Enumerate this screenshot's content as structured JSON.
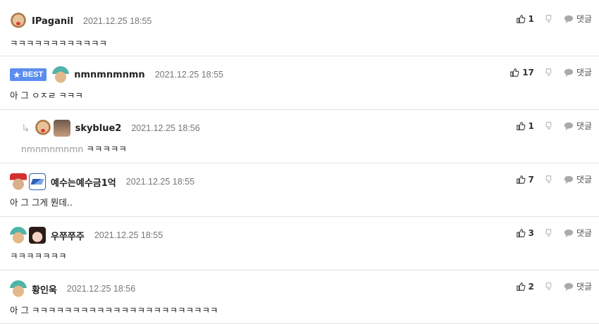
{
  "icons": {
    "thumb_up": "thumbs-up-icon",
    "thumb_down": "thumbs-down-icon",
    "reply": "speech-bubble-icon",
    "best_star": "star-icon",
    "reply_arrow": "reply-arrow-icon"
  },
  "colors": {
    "best_badge": "#5b8def",
    "divider": "#e3e3e3",
    "muted": "#777777"
  },
  "actions": {
    "reply_label": "댓글"
  },
  "comments": [
    {
      "nickname": "IPaganil",
      "date": "2021.12.25 18:55",
      "text": "ㅋㅋㅋㅋㅋㅋㅋㅋㅋㅋㅋㅋ",
      "upvotes": "1",
      "best": false,
      "reply": false,
      "mention": ""
    },
    {
      "badge": "BEST",
      "nickname": "nmnmnmnmn",
      "date": "2021.12.25 18:55",
      "text": "아 그 ㅇㅈㄹ ㅋㅋㅋ",
      "upvotes": "17",
      "best": true,
      "reply": false,
      "mention": ""
    },
    {
      "nickname": "skyblue2",
      "date": "2021.12.25 18:56",
      "mention": "nmnmnmnmn",
      "text": "ㅋㅋㅋㅋㅋ",
      "upvotes": "1",
      "best": false,
      "reply": true
    },
    {
      "nickname": "예수는예수금1억",
      "date": "2021.12.25 18:55",
      "text": "아 그 그게 뭔데..",
      "upvotes": "7",
      "best": false,
      "reply": false,
      "mention": ""
    },
    {
      "nickname": "우쭈쭈주",
      "date": "2021.12.25 18:55",
      "text": "ㅋㅋㅋㅋㅋㅋㅋ",
      "upvotes": "3",
      "best": false,
      "reply": false,
      "mention": ""
    },
    {
      "nickname": "황인욱",
      "date": "2021.12.25 18:56",
      "text": "아 그 ㅋㅋㅋㅋㅋㅋㅋㅋㅋㅋㅋㅋㅋㅋㅋㅋㅋㅋㅋㅋㅋㅋㅋ",
      "upvotes": "2",
      "best": false,
      "reply": false,
      "mention": ""
    }
  ]
}
